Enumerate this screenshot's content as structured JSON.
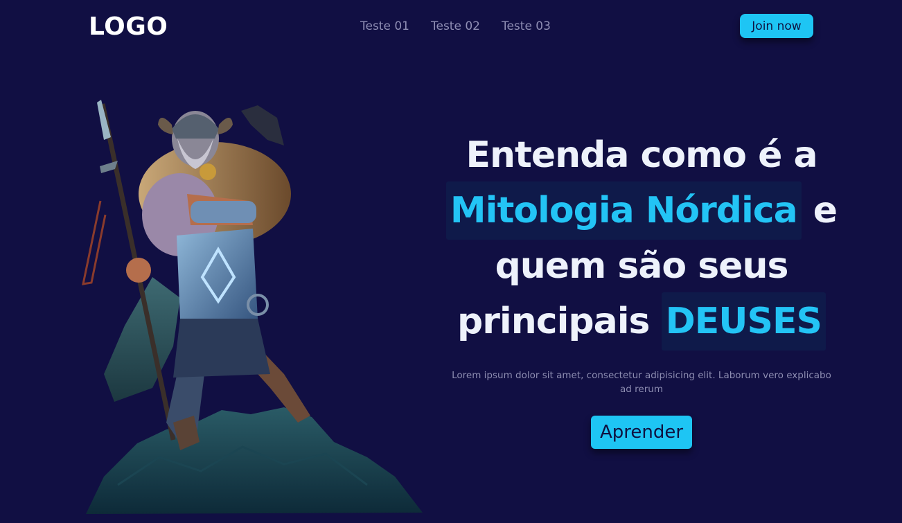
{
  "header": {
    "logo": "LOGO",
    "nav": [
      "Teste 01",
      "Teste 02",
      "Teste 03"
    ],
    "cta_label": "Join now"
  },
  "hero": {
    "headline": {
      "line1": "Entenda como é a",
      "highlight1": "Mitologia Nórdica",
      "after_highlight1": " e",
      "line3": "quem são seus",
      "line4_prefix": "principais ",
      "highlight2": "DEUSES"
    },
    "description": "Lorem ipsum dolor sit amet, consectetur adipisicing elit. Laborum vero explicabo ad rerum",
    "button_label": "Aprender"
  },
  "colors": {
    "background": "#110f43",
    "accent": "#1ec5f4",
    "highlight_bg": "#0f1a4a",
    "muted_text": "#8d8db1"
  }
}
